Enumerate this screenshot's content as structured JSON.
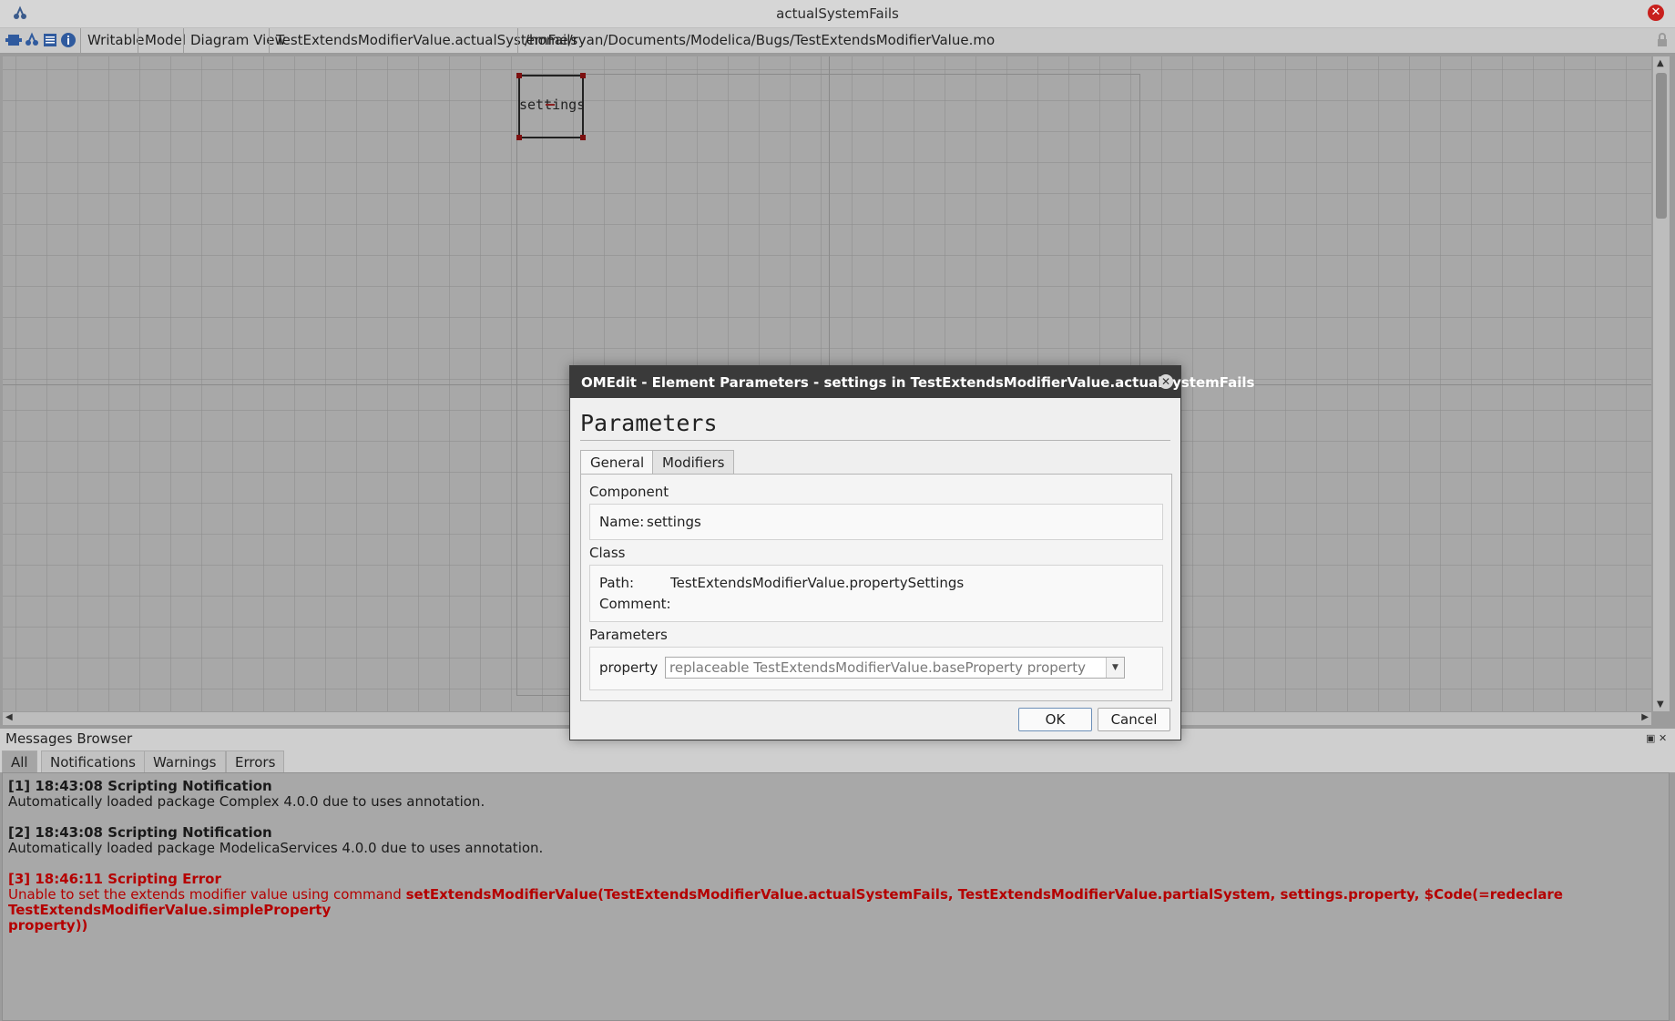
{
  "window": {
    "title": "actualSystemFails"
  },
  "toolbar": {
    "writable": "Writable",
    "model": "Model",
    "view": "Diagram View",
    "class_name": "TestExtendsModifierValue.actualSystemFails",
    "file_path": "/home/ryan/Documents/Modelica/Bugs/TestExtendsModifierValue.mo"
  },
  "diagram": {
    "component_label": "settings"
  },
  "dialog": {
    "title": "OMEdit - Element Parameters - settings in TestExtendsModifierValue.actualSystemFails",
    "heading": "Parameters",
    "tabs": [
      "General",
      "Modifiers"
    ],
    "component_section": "Component",
    "name_label": "Name:",
    "name_value": "settings",
    "class_section": "Class",
    "path_label": "Path:",
    "path_value": "TestExtendsModifierValue.propertySettings",
    "comment_label": "Comment:",
    "parameters_section": "Parameters",
    "param_name": "property",
    "param_value": "replaceable TestExtendsModifierValue.baseProperty property",
    "ok_label": "OK",
    "cancel_label": "Cancel"
  },
  "messages": {
    "title": "Messages Browser",
    "tabs": [
      "All",
      "Notifications",
      "Warnings",
      "Errors"
    ],
    "items": [
      {
        "head": "[1] 18:43:08 Scripting Notification",
        "body": "Automatically loaded package Complex 4.0.0 due to uses annotation."
      },
      {
        "head": "[2] 18:43:08 Scripting Notification",
        "body": "Automatically loaded package ModelicaServices 4.0.0 due to uses annotation."
      },
      {
        "head": "[3] 18:46:11 Scripting Error",
        "body": "Unable to set the extends modifier value using command ",
        "command": "setExtendsModifierValue(TestExtendsModifierValue.actualSystemFails, TestExtendsModifierValue.partialSystem, settings.property, $Code(=redeclare TestExtendsModifierValue.simpleProperty",
        "command_cont": "property))"
      }
    ]
  },
  "colors": {
    "error": "#b50000",
    "close": "#c8201d",
    "dialog_title_bg": "#3a3a3a"
  },
  "icons": [
    "omedit-icon",
    "close-icon",
    "modeling-icon",
    "diagram-icon",
    "text-icon",
    "info-icon",
    "lock-icon",
    "dropdown-icon"
  ]
}
